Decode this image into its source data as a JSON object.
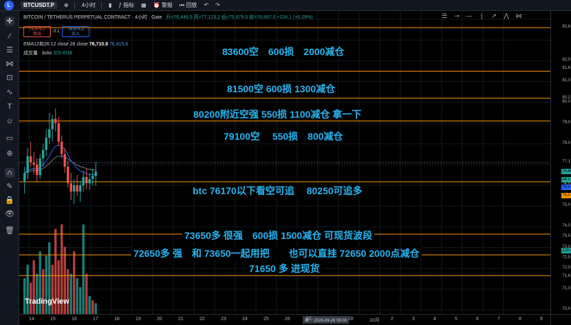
{
  "toolbar": {
    "logo": "L",
    "symbol": "BTCUSDT.P",
    "interval": "4小时",
    "indicators": "指标",
    "alert": "警报",
    "replay": "回放"
  },
  "legend": {
    "pair": "BITCOIN / TETHERUS PERPETUAL CONTRACT · 4小时 · Gate",
    "ohlc": "开=76,446.5  高=77,123.2  低=75,979.5  收=76,667.0 +224.1 (+0.29%)",
    "sell_price": "76,676.2",
    "sell_label": "卖出",
    "spread": "0.1",
    "buy_price": "76,676.3",
    "buy_label": "买入",
    "ema_label": "EMA12和26 12 close 26 close",
    "ema_v1": "76,710.8",
    "ema_v2": "76,415.6",
    "vol_label": "成交量 · ticks",
    "vol_value": "329.81M"
  },
  "annotations": [
    {
      "text": "83600空　600损　2000减仓"
    },
    {
      "text": "81500空  600损 1300减仓"
    },
    {
      "text": "80200附近空强  550损  1100减仓 拿一下"
    },
    {
      "text": "79100空　 550损　800减仓"
    },
    {
      "text": "btc 76170以下看空可追　 80250可追多"
    },
    {
      "text": "73650多 很强　600损  1500减仓 可现货波段"
    },
    {
      "text": "72650多  强　和 73650一起用把　　也可以直挂 72650 2000点减仓"
    },
    {
      "text": "71650 多  进现货"
    }
  ],
  "price_axis": {
    "ticks": [
      "83,6",
      "82,0",
      "81,6",
      "81,0",
      "80,2",
      "80,0",
      "79,0",
      "78,0",
      "77,1",
      "76,0",
      "75,0",
      "74,0",
      "73,5",
      "73,0",
      "72,5",
      "72,0",
      "71,6",
      "71,0",
      "70,0"
    ],
    "tags": [
      {
        "text": "76,66",
        "color": "#26a69a"
      },
      {
        "text": "04:1",
        "color": "#26a69a"
      },
      {
        "text": "76,4",
        "color": "#2962ff"
      },
      {
        "text": "76,0",
        "color": "#ff9800"
      },
      {
        "text": "229.8",
        "color": "#26a69a"
      }
    ]
  },
  "time_axis": {
    "ticks": [
      "14",
      "15",
      "16",
      "17",
      "18",
      "19",
      "20",
      "21",
      "22",
      "23",
      "24",
      "25",
      "26",
      "27",
      "28",
      "10月",
      "2",
      "3",
      "4",
      "5",
      "6",
      "7",
      "8",
      "9"
    ],
    "cursor": "周一 2026-09-28  08:00"
  },
  "watermark": "TradingView",
  "colors": {
    "level_line": "#ff9800",
    "annotation_text": "#27b5f2",
    "up": "#26a69a",
    "down": "#ef5350"
  },
  "chart_data": {
    "type": "candlestick",
    "interval": "4小时",
    "candles": [
      {
        "o": 76200,
        "h": 76900,
        "l": 75600,
        "c": 76600
      },
      {
        "o": 76600,
        "h": 77800,
        "l": 76300,
        "c": 77400
      },
      {
        "o": 77400,
        "h": 78100,
        "l": 76900,
        "c": 77100
      },
      {
        "o": 77100,
        "h": 77600,
        "l": 76500,
        "c": 77000
      },
      {
        "o": 77000,
        "h": 77300,
        "l": 76200,
        "c": 76500
      },
      {
        "o": 76500,
        "h": 77500,
        "l": 76300,
        "c": 77300
      },
      {
        "o": 77300,
        "h": 78000,
        "l": 76900,
        "c": 77700
      },
      {
        "o": 77700,
        "h": 78700,
        "l": 77400,
        "c": 78300
      },
      {
        "o": 78300,
        "h": 79500,
        "l": 78000,
        "c": 78700
      },
      {
        "o": 78700,
        "h": 79400,
        "l": 78100,
        "c": 79200
      },
      {
        "o": 79200,
        "h": 79700,
        "l": 78600,
        "c": 79000
      },
      {
        "o": 79000,
        "h": 79300,
        "l": 77900,
        "c": 78100
      },
      {
        "o": 78100,
        "h": 78400,
        "l": 77300,
        "c": 77500
      },
      {
        "o": 77500,
        "h": 77800,
        "l": 76600,
        "c": 76900
      },
      {
        "o": 76900,
        "h": 77200,
        "l": 75900,
        "c": 76100
      },
      {
        "o": 76100,
        "h": 76600,
        "l": 75300,
        "c": 75700
      },
      {
        "o": 75700,
        "h": 76300,
        "l": 75100,
        "c": 76000
      },
      {
        "o": 76000,
        "h": 76500,
        "l": 75500,
        "c": 75700
      },
      {
        "o": 75700,
        "h": 76200,
        "l": 75200,
        "c": 76000
      },
      {
        "o": 76000,
        "h": 76700,
        "l": 75700,
        "c": 76400
      },
      {
        "o": 76400,
        "h": 76800,
        "l": 75800,
        "c": 76100
      },
      {
        "o": 76100,
        "h": 76600,
        "l": 75800,
        "c": 76300
      },
      {
        "o": 76300,
        "h": 76800,
        "l": 76000,
        "c": 76446
      },
      {
        "o": 76446,
        "h": 77123,
        "l": 75979,
        "c": 76667
      }
    ],
    "levels": [
      83600,
      81500,
      80200,
      79100,
      76170,
      73650,
      72650,
      71650
    ],
    "current_price": 77100,
    "volume": [
      {
        "v": 40,
        "up": true
      },
      {
        "v": 55,
        "up": true
      },
      {
        "v": 35,
        "up": false
      },
      {
        "v": 60,
        "up": false
      },
      {
        "v": 45,
        "up": true
      },
      {
        "v": 70,
        "up": true
      },
      {
        "v": 50,
        "up": false
      },
      {
        "v": 65,
        "up": true
      },
      {
        "v": 80,
        "up": true
      },
      {
        "v": 55,
        "up": false
      },
      {
        "v": 95,
        "up": false
      },
      {
        "v": 60,
        "up": false
      },
      {
        "v": 100,
        "up": false
      },
      {
        "v": 75,
        "up": false
      },
      {
        "v": 50,
        "up": false
      },
      {
        "v": 45,
        "up": true
      },
      {
        "v": 70,
        "up": false
      },
      {
        "v": 40,
        "up": true
      },
      {
        "v": 30,
        "up": true
      },
      {
        "v": 100,
        "up": true
      },
      {
        "v": 45,
        "up": false
      },
      {
        "v": 20,
        "up": true
      },
      {
        "v": 15,
        "up": false
      },
      {
        "v": 12,
        "up": true
      }
    ],
    "ylim": [
      69800,
      84400
    ]
  }
}
